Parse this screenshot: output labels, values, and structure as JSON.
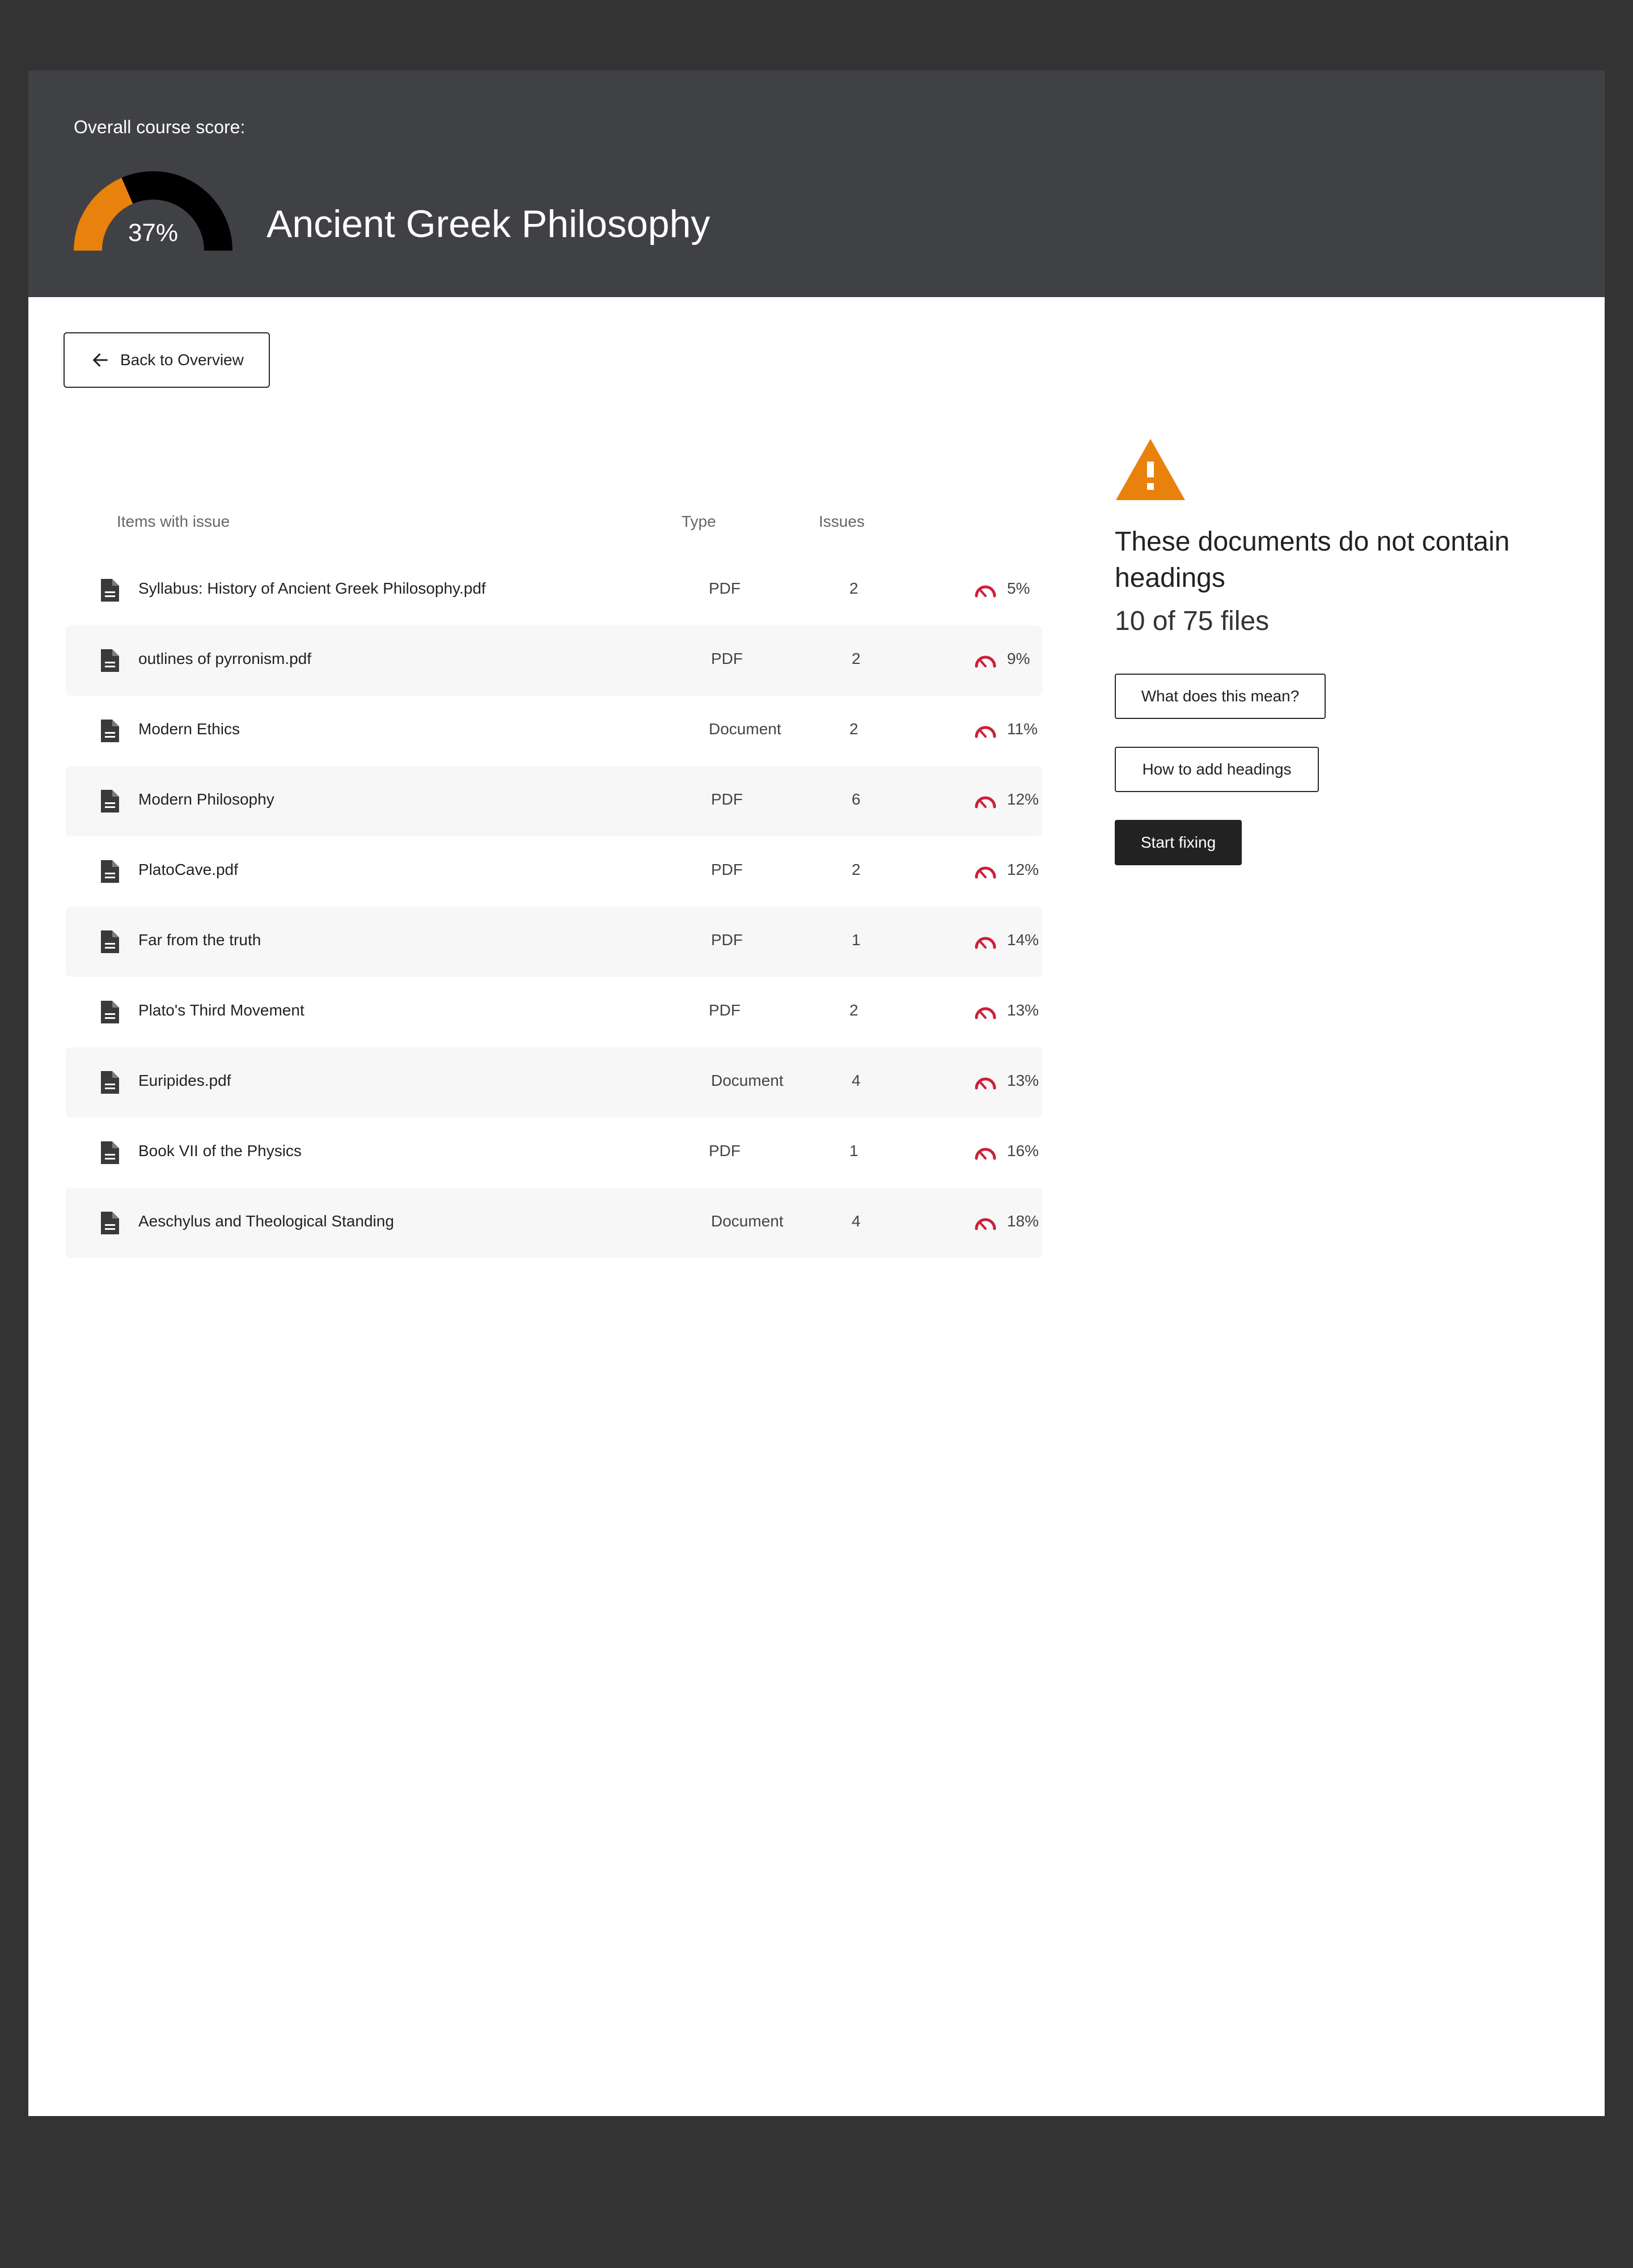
{
  "header": {
    "score_label": "Overall course score:",
    "score_value": 0.37,
    "score_text": "37%",
    "course_title": "Ancient Greek Philosophy",
    "colors": {
      "gauge_fill": "#E8820C",
      "gauge_track": "#000000",
      "header_bg": "#404145"
    }
  },
  "back_button": {
    "label": "Back to Overview",
    "icon": "arrow-left-icon"
  },
  "table": {
    "columns": {
      "item": "Items with issue",
      "type": "Type",
      "issues": "Issues"
    },
    "rows": [
      {
        "name": "Syllabus: History of Ancient Greek Philosophy.pdf",
        "type": "PDF",
        "issues": "2",
        "score": "5%"
      },
      {
        "name": "outlines of pyrronism.pdf",
        "type": "PDF",
        "issues": "2",
        "score": "9%"
      },
      {
        "name": "Modern Ethics",
        "type": "Document",
        "issues": "2",
        "score": "11%"
      },
      {
        "name": "Modern Philosophy",
        "type": "PDF",
        "issues": "6",
        "score": "12%"
      },
      {
        "name": "PlatoCave.pdf",
        "type": "PDF",
        "issues": "2",
        "score": "12%"
      },
      {
        "name": "Far from the truth",
        "type": "PDF",
        "issues": "1",
        "score": "14%"
      },
      {
        "name": "Plato's Third Movement",
        "type": "PDF",
        "issues": "2",
        "score": "13%"
      },
      {
        "name": "Euripides.pdf",
        "type": "Document",
        "issues": "4",
        "score": "13%"
      },
      {
        "name": "Book VII of the Physics",
        "type": "PDF",
        "issues": "1",
        "score": "16%"
      },
      {
        "name": "Aeschylus and Theological Standing",
        "type": "Document",
        "issues": "4",
        "score": "18%"
      }
    ],
    "icons": {
      "row_icon": "document-icon",
      "score_icon": "gauge-meter-icon"
    },
    "colors": {
      "meter": "#CC1F3A",
      "alt_row": "#F7F7F7"
    }
  },
  "panel": {
    "icon": "warning-icon",
    "icon_color": "#E8820C",
    "title": "These documents do not contain headings",
    "subtitle": "10 of 75 files",
    "buttons": {
      "what_means": "What does this mean?",
      "how_to": "How to add headings",
      "start": "Start fixing"
    }
  }
}
